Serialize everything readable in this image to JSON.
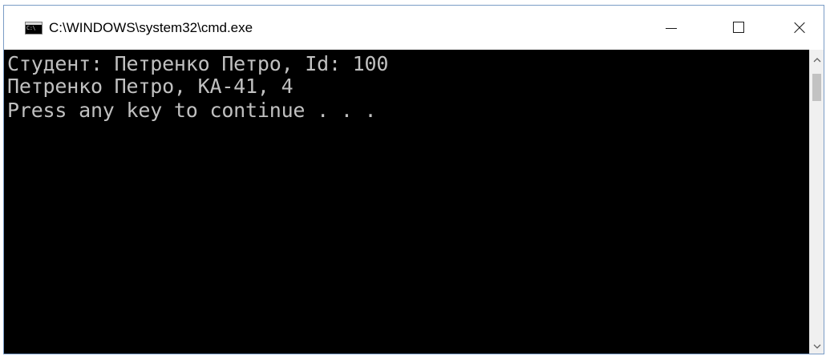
{
  "window": {
    "title": "C:\\WINDOWS\\system32\\cmd.exe",
    "icon": "cmd-console-icon",
    "icon_text": "C:\\"
  },
  "controls": {
    "minimize_icon": "minimize-icon",
    "maximize_icon": "maximize-icon",
    "close_icon": "close-icon"
  },
  "console": {
    "lines": [
      "Студент: Петренко Петро, Id: 100",
      "Петренко Петро, КА-41, 4",
      "Press any key to continue . . ."
    ],
    "background": "#000000",
    "foreground": "#c0c0c0"
  },
  "scrollbar": {
    "up_icon": "scroll-up-icon",
    "down_icon": "scroll-down-icon"
  }
}
